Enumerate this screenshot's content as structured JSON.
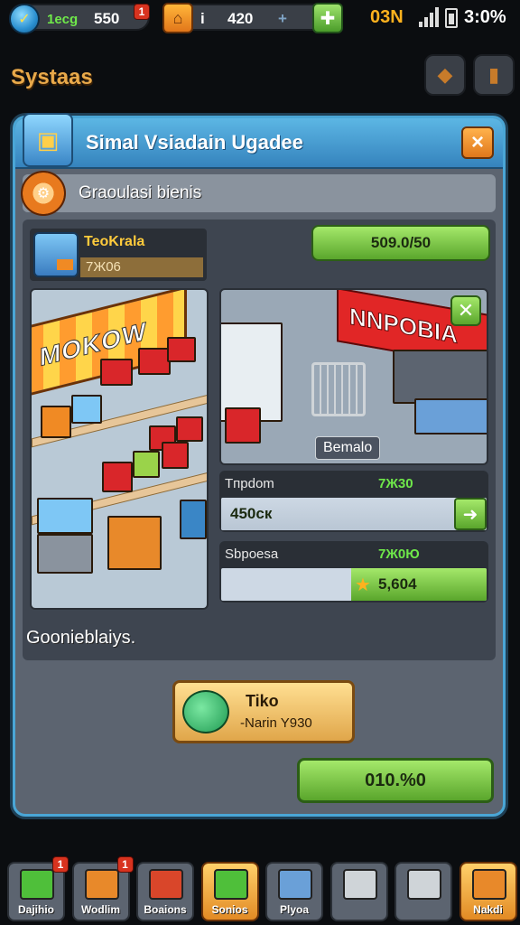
{
  "status_bar": {
    "currency1_label": "1ecg",
    "currency1_value": "550",
    "currency1_badge": "1",
    "currency2_label": "i",
    "currency2_value": "420",
    "carrier": "03N",
    "time": "3:0%"
  },
  "header": {
    "title": "Systaas"
  },
  "dialog": {
    "title": "Simal Vsiadain Ugadee",
    "close_glyph": "×",
    "subtitle": "Graoulasi bienis",
    "store": {
      "name": "TeoKrala",
      "price": "7Ж06",
      "progress": "509.0/50"
    },
    "shop_banner": "MOKOW",
    "store_sign": "NNPOBIA",
    "store_caption": "Bemalo",
    "stat1": {
      "label": "Tпрdom",
      "value": "7Ж30",
      "bar_text": "450ск",
      "fill_fraction": 0.88
    },
    "stat2": {
      "label": "Sbpoesa",
      "value": "7Ж0Ю",
      "bar_text": "5,604",
      "fill_fraction": 0.51
    },
    "footer_label": "Goonieblaiys.",
    "reward": {
      "line1": "Tiko",
      "line2": "-Narin  Y930"
    },
    "confirm_label": "010.%0"
  },
  "nav": [
    {
      "label": "Dajihio",
      "badge": "1",
      "color": "#4fbf3a",
      "active": false
    },
    {
      "label": "Wodlim",
      "badge": "1",
      "color": "#e8892a",
      "active": false
    },
    {
      "label": "Boaions",
      "badge": "",
      "color": "#d9462a",
      "active": false
    },
    {
      "label": "Sonios",
      "badge": "",
      "color": "#4fbf3a",
      "active": true
    },
    {
      "label": "Plyoa",
      "badge": "",
      "color": "#6aa0d8",
      "active": false
    },
    {
      "label": "",
      "badge": "",
      "color": "#cfd4d8",
      "active": false
    },
    {
      "label": "",
      "badge": "",
      "color": "#cfd4d8",
      "active": false
    },
    {
      "label": "Nakdi",
      "badge": "",
      "color": "#e8892a",
      "active": true
    }
  ]
}
